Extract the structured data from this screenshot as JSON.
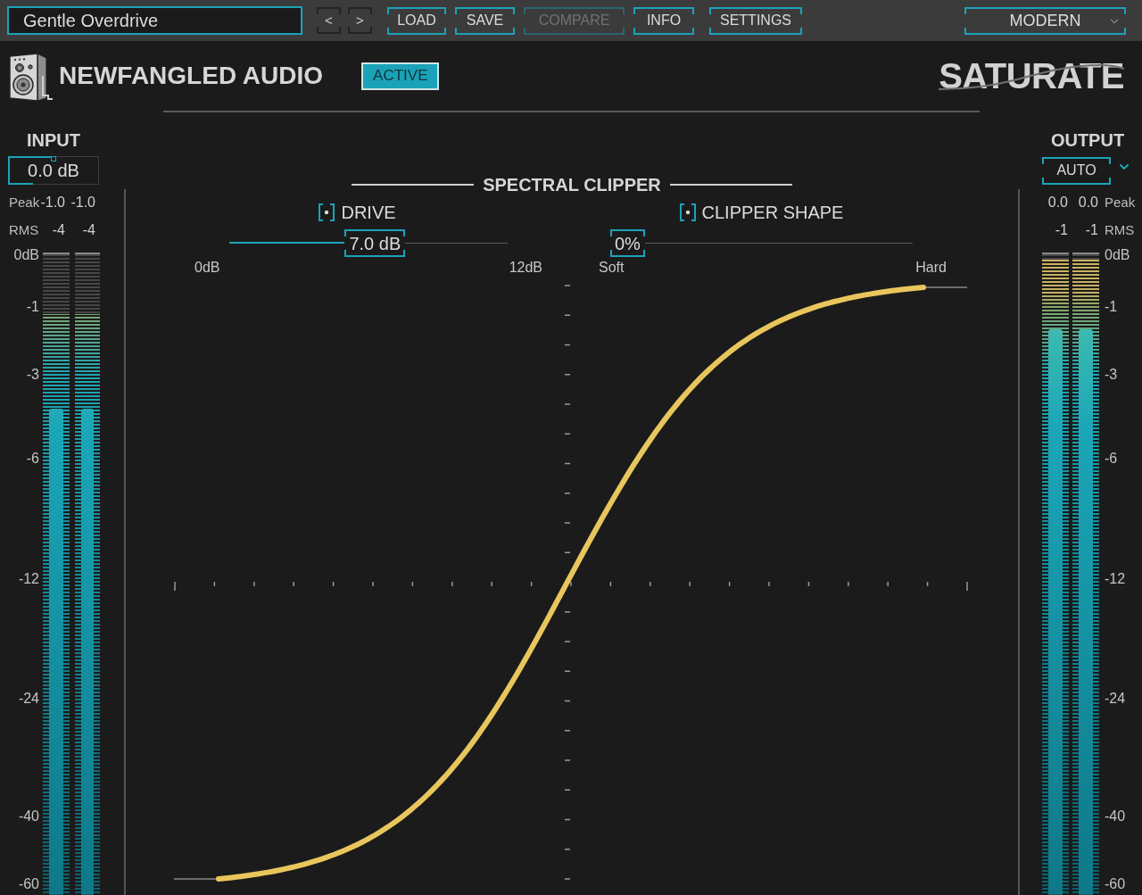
{
  "toolbar": {
    "preset_field": {
      "value": "Gentle Overdrive"
    },
    "nav_buttons": [
      {
        "label": "<"
      },
      {
        "label": ">"
      }
    ],
    "buttons": [
      {
        "label": "LOAD",
        "disabled": false
      },
      {
        "label": "SAVE",
        "disabled": false
      },
      {
        "label": "COMPARE",
        "disabled": true
      },
      {
        "label": "INFO",
        "disabled": false
      },
      {
        "label": "SETTINGS",
        "disabled": false
      }
    ],
    "mode_dropdown": {
      "value": "MODERN"
    }
  },
  "header": {
    "brand": "NEWFANGLED AUDIO",
    "active_button": {
      "label": "ACTIVE",
      "on": true
    },
    "product_name": "SATURATE"
  },
  "input": {
    "title": "INPUT",
    "gain_field": {
      "value": "0.0 dB",
      "level": 0.5
    },
    "peak": {
      "label": "Peak",
      "values": [
        "-1.0",
        "-1.0"
      ]
    },
    "rms": {
      "label": "RMS",
      "values": [
        "-4",
        "-4"
      ]
    },
    "meters": [
      {
        "peak": {
          "level": 0.915
        },
        "rms": {
          "level": 0.765
        }
      },
      {
        "peak": {
          "level": 0.915
        },
        "rms": {
          "level": 0.765
        }
      }
    ],
    "scale": [
      "0dB",
      "-1",
      "-3",
      "-6",
      "-12",
      "-24",
      "-40",
      "-60"
    ]
  },
  "spectral_clipper": {
    "title": "SPECTRAL CLIPPER",
    "controls": [
      {
        "label": "DRIVE",
        "value": "7.0 dB",
        "level": 0.53,
        "min_label": "0dB",
        "max_label": "12dB"
      },
      {
        "label": "CLIPPER SHAPE",
        "value": "0%",
        "level": 0,
        "min_label": "Soft",
        "max_label": "Hard"
      }
    ]
  },
  "output": {
    "title": "OUTPUT",
    "mode_button": {
      "label": "AUTO"
    },
    "peak": {
      "label": "Peak",
      "values": [
        "0.0",
        "0.0"
      ]
    },
    "rms": {
      "label": "RMS",
      "values": [
        "-1",
        "-1"
      ]
    },
    "meters": [
      {
        "peak": {
          "level": 1
        },
        "rms": {
          "level": 0.89
        }
      },
      {
        "peak": {
          "level": 1
        },
        "rms": {
          "level": 0.89
        }
      }
    ],
    "scale": [
      "0dB",
      "-1",
      "-3",
      "-6",
      "-12",
      "-24",
      "-40",
      "-60"
    ]
  }
}
